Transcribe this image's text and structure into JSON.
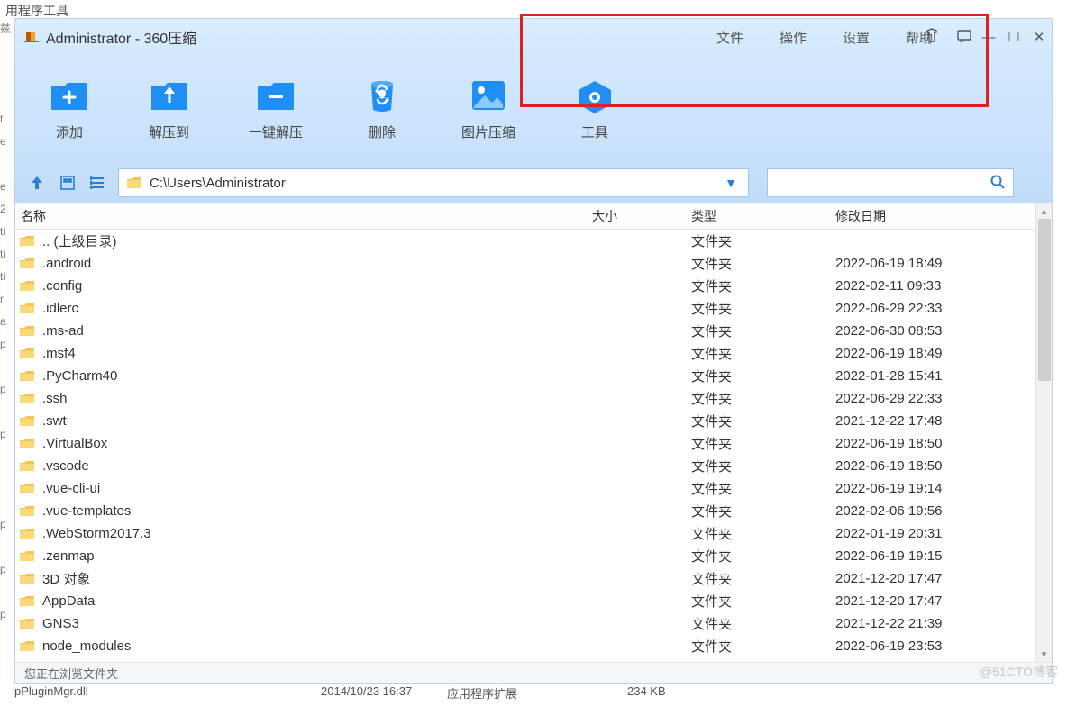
{
  "bg": {
    "top_fragment": "用程序工具",
    "bottom_row": {
      "c1": "pPluginMgr.dll",
      "c2": "2014/10/23 16:37",
      "c3": "应用程序扩展",
      "c4": "234 KB"
    }
  },
  "window": {
    "title": "Administrator - 360压缩",
    "menus": [
      "文件",
      "操作",
      "设置",
      "帮助"
    ],
    "toolbar": [
      {
        "key": "add",
        "label": "添加"
      },
      {
        "key": "extract_to",
        "label": "解压到"
      },
      {
        "key": "one_click_extract",
        "label": "一键解压"
      },
      {
        "key": "delete",
        "label": "删除"
      },
      {
        "key": "image_compress",
        "label": "图片压缩"
      },
      {
        "key": "tools",
        "label": "工具"
      }
    ],
    "path": "C:\\Users\\Administrator",
    "search_placeholder": "",
    "columns": {
      "name": "名称",
      "size": "大小",
      "type": "类型",
      "date": "修改日期"
    },
    "files": [
      {
        "name": ".. (上级目录)",
        "size": "",
        "type": "文件夹",
        "date": ""
      },
      {
        "name": ".android",
        "size": "",
        "type": "文件夹",
        "date": "2022-06-19 18:49"
      },
      {
        "name": ".config",
        "size": "",
        "type": "文件夹",
        "date": "2022-02-11 09:33"
      },
      {
        "name": ".idlerc",
        "size": "",
        "type": "文件夹",
        "date": "2022-06-29 22:33"
      },
      {
        "name": ".ms-ad",
        "size": "",
        "type": "文件夹",
        "date": "2022-06-30 08:53"
      },
      {
        "name": ".msf4",
        "size": "",
        "type": "文件夹",
        "date": "2022-06-19 18:49"
      },
      {
        "name": ".PyCharm40",
        "size": "",
        "type": "文件夹",
        "date": "2022-01-28 15:41"
      },
      {
        "name": ".ssh",
        "size": "",
        "type": "文件夹",
        "date": "2022-06-29 22:33"
      },
      {
        "name": ".swt",
        "size": "",
        "type": "文件夹",
        "date": "2021-12-22 17:48"
      },
      {
        "name": ".VirtualBox",
        "size": "",
        "type": "文件夹",
        "date": "2022-06-19 18:50"
      },
      {
        "name": ".vscode",
        "size": "",
        "type": "文件夹",
        "date": "2022-06-19 18:50"
      },
      {
        "name": ".vue-cli-ui",
        "size": "",
        "type": "文件夹",
        "date": "2022-06-19 19:14"
      },
      {
        "name": ".vue-templates",
        "size": "",
        "type": "文件夹",
        "date": "2022-02-06 19:56"
      },
      {
        "name": ".WebStorm2017.3",
        "size": "",
        "type": "文件夹",
        "date": "2022-01-19 20:31"
      },
      {
        "name": ".zenmap",
        "size": "",
        "type": "文件夹",
        "date": "2022-06-19 19:15"
      },
      {
        "name": "3D 对象",
        "size": "",
        "type": "文件夹",
        "date": "2021-12-20 17:47"
      },
      {
        "name": "AppData",
        "size": "",
        "type": "文件夹",
        "date": "2021-12-20 17:47"
      },
      {
        "name": "GNS3",
        "size": "",
        "type": "文件夹",
        "date": "2021-12-22 21:39"
      },
      {
        "name": "node_modules",
        "size": "",
        "type": "文件夹",
        "date": "2022-06-19 23:53"
      }
    ],
    "status": "您正在浏览文件夹"
  },
  "watermark": "@51CTO博客"
}
